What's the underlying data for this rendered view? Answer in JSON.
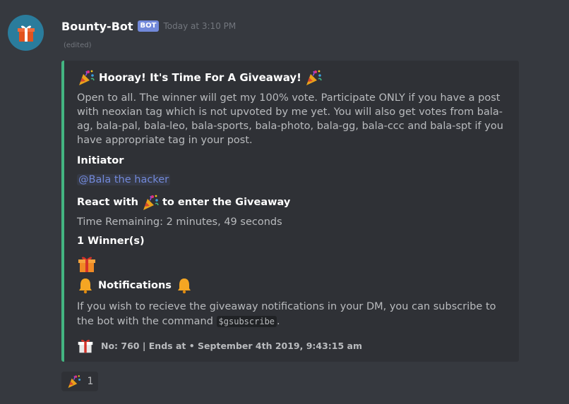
{
  "message": {
    "username": "Bounty-Bot",
    "bot_tag": "BOT",
    "timestamp": "Today at 3:10 PM",
    "edited": "(edited)",
    "avatar_icon": "gift-icon"
  },
  "embed": {
    "accent_color": "#43b581",
    "title": "Hooray! It's Time For A Giveaway!",
    "description": "Open to all. The winner will get my 100% vote. Participate ONLY if you have a post with neoxian tag which is not upvoted by me yet. You will also get votes from bala-ag, bala-pal, bala-leo, bala-sports, bala-photo, bala-gg, bala-ccc and bala-spt if you have appropriate tag in your post.",
    "initiator_label": "Initiator",
    "initiator_mention": "@Bala the hacker",
    "react_prefix": "React with",
    "react_suffix": "to enter the Giveaway",
    "time_remaining": "Time Remaining: 2 minutes, 49 seconds",
    "winners": "1 Winner(s)",
    "notifications_label": "Notifications",
    "notifications_text_1": "If you wish to recieve the giveaway notifications in your DM, you can subscribe to the bot with the command",
    "notifications_command": "$gsubscribe",
    "notifications_text_2": ".",
    "footer": "No: 760 | Ends at • September 4th 2019, 9:43:15 am"
  },
  "reaction": {
    "emoji": "party-popper-icon",
    "count": "1"
  }
}
